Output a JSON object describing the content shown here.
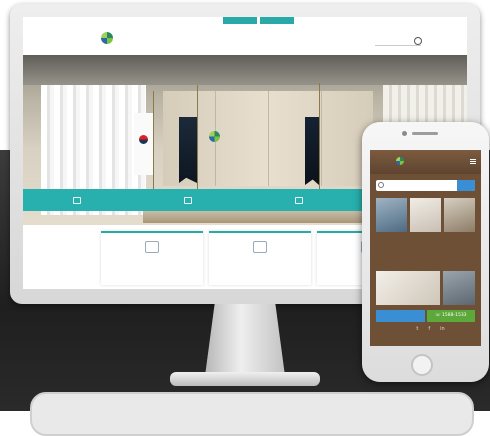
{
  "desktop": {
    "quick_tabs": [
      "",
      ""
    ],
    "util_links": [
      "",
      "",
      ""
    ],
    "logo_text": "",
    "logo_sub": "",
    "nav": [
      "",
      "",
      "",
      "",
      ""
    ],
    "search_placeholder": "",
    "hero_wall_text": "",
    "quick_menu": [
      "",
      "",
      "",
      ""
    ],
    "cards": [
      "",
      "",
      ""
    ]
  },
  "mobile": {
    "logo_text": "",
    "logo_sub": "",
    "search_placeholder": "",
    "search_button": "",
    "tiles": [
      "",
      "",
      "",
      ""
    ],
    "wide_tiles": [
      "",
      ""
    ],
    "action_left": "",
    "phone_number": "1588-1533",
    "social": [
      "",
      "t",
      "f",
      "in"
    ],
    "footer_text": ""
  },
  "colors": {
    "teal": "#27b0ad",
    "mobile_brown": "#6e5037",
    "mobile_blue": "#3a8fd4",
    "mobile_green": "#5ca83b"
  }
}
